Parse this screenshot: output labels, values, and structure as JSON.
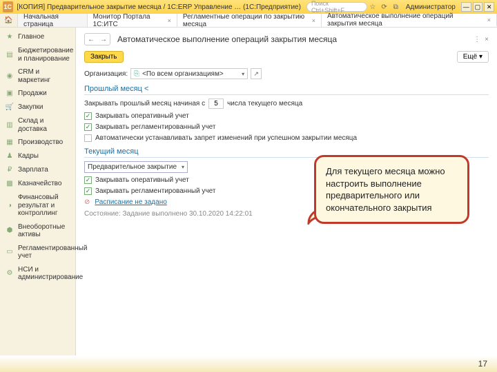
{
  "titlebar": {
    "logo": "1C",
    "title": "[КОПИЯ] Предварительное закрытие месяца / 1С:ERP Управление …   (1С:Предприятие)",
    "search_placeholder": "Поиск Ctrl+Shift+F",
    "user": "Администратор",
    "icons": [
      "☆",
      "⟳",
      "⧉"
    ]
  },
  "tabs": {
    "start": "Начальная страница",
    "items": [
      "Монитор Портала 1С:ИТС",
      "Регламентные операции по закрытию месяца",
      "Автоматическое выполнение операций закрытия месяца"
    ]
  },
  "sidebar": {
    "items": [
      "Главное",
      "Бюджетирование и планирование",
      "CRM и маркетинг",
      "Продажи",
      "Закупки",
      "Склад и доставка",
      "Производство",
      "Кадры",
      "Зарплата",
      "Казначейство",
      "Финансовый результат и контроллинг",
      "Внеоборотные активы",
      "Регламентированный учет",
      "НСИ и администрирование"
    ]
  },
  "main": {
    "title": "Автоматическое выполнение операций закрытия месяца",
    "close_btn": "Закрыть",
    "more_btn": "Ещё",
    "org_label": "Организация:",
    "org_value": "<По всем организациям>",
    "sect_prev": "Прошлый месяц",
    "prev_line_a": "Закрывать прошлый месяц начиная с",
    "prev_day": "5",
    "prev_line_b": "числа текущего месяца",
    "chk_oper": "Закрывать оперативный учет",
    "chk_regl": "Закрывать регламентированный учет",
    "chk_auto": "Автоматически устанавливать запрет изменений при успешном закрытии месяца",
    "sect_cur": "Текущий месяц",
    "cur_select": "Предварительное закрытие",
    "schedule": "Расписание не задано",
    "status_label": "Состояние:",
    "status_value": "Задание выполнено 30.10.2020 14:22:01"
  },
  "callout": "Для текущего месяца можно настроить выполнение предварительного или окончательного закрытия",
  "footer": {
    "page": "17"
  }
}
